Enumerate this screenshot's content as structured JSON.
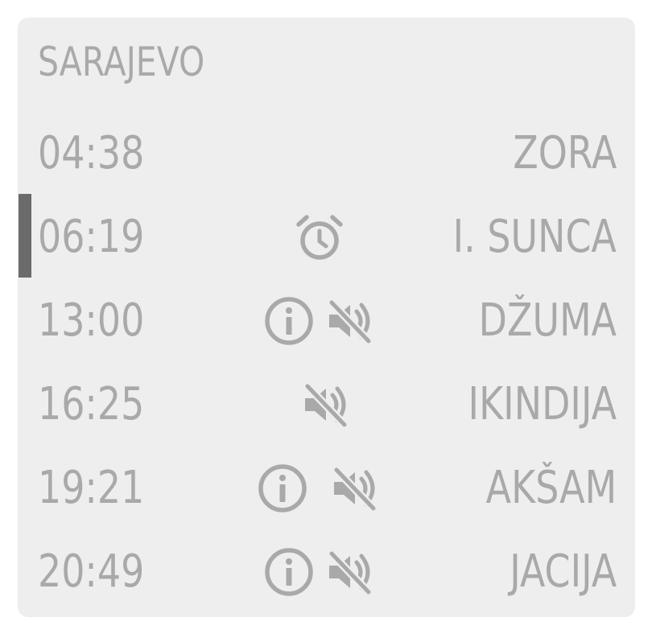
{
  "widget": {
    "city": "SARAJEVO",
    "icon_color": "#a9a9a9",
    "active_color": "#6b6b6b",
    "prayers": [
      {
        "time": "04:38",
        "name": "ZORA",
        "icons": []
      },
      {
        "time": "06:19",
        "name": "I. SUNCA",
        "icons": [
          "alarm-icon"
        ],
        "active": true
      },
      {
        "time": "13:00",
        "name": "DŽUMA",
        "icons": [
          "info-icon",
          "muted-speaker-icon"
        ]
      },
      {
        "time": "16:25",
        "name": "IKINDIJA",
        "icons": [
          "muted-speaker-icon"
        ]
      },
      {
        "time": "19:21",
        "name": "AKŠAM",
        "icons": [
          "info-icon",
          "muted-speaker-icon"
        ]
      },
      {
        "time": "20:49",
        "name": "JACIJA",
        "icons": [
          "info-icon",
          "muted-speaker-icon"
        ]
      }
    ]
  }
}
